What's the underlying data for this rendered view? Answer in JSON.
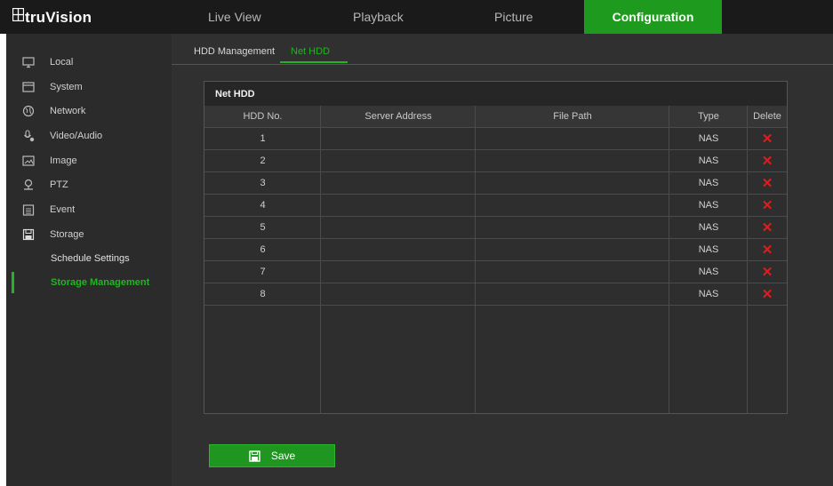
{
  "brand": {
    "logo_text": "truVision"
  },
  "nav": {
    "tabs": [
      {
        "label": "Live View"
      },
      {
        "label": "Playback"
      },
      {
        "label": "Picture"
      },
      {
        "label": "Configuration",
        "active": true
      }
    ]
  },
  "sidebar": {
    "items": [
      {
        "label": "Local",
        "icon": "monitor-icon"
      },
      {
        "label": "System",
        "icon": "system-icon"
      },
      {
        "label": "Network",
        "icon": "globe-icon"
      },
      {
        "label": "Video/Audio",
        "icon": "microphone-icon"
      },
      {
        "label": "Image",
        "icon": "image-icon"
      },
      {
        "label": "PTZ",
        "icon": "ptz-camera-icon"
      },
      {
        "label": "Event",
        "icon": "calendar-icon"
      },
      {
        "label": "Storage",
        "icon": "storage-icon"
      }
    ],
    "subitems": [
      {
        "label": "Schedule Settings",
        "active": false
      },
      {
        "label": "Storage Management",
        "active": true
      }
    ]
  },
  "subtabs": [
    {
      "label": "HDD Management",
      "active": false
    },
    {
      "label": "Net HDD",
      "active": true
    }
  ],
  "table": {
    "title": "Net HDD",
    "columns": [
      "HDD No.",
      "Server Address",
      "File Path",
      "Type",
      "Delete"
    ],
    "rows": [
      {
        "no": "1",
        "server": "",
        "path": "",
        "type": "NAS"
      },
      {
        "no": "2",
        "server": "",
        "path": "",
        "type": "NAS"
      },
      {
        "no": "3",
        "server": "",
        "path": "",
        "type": "NAS"
      },
      {
        "no": "4",
        "server": "",
        "path": "",
        "type": "NAS"
      },
      {
        "no": "5",
        "server": "",
        "path": "",
        "type": "NAS"
      },
      {
        "no": "6",
        "server": "",
        "path": "",
        "type": "NAS"
      },
      {
        "no": "7",
        "server": "",
        "path": "",
        "type": "NAS"
      },
      {
        "no": "8",
        "server": "",
        "path": "",
        "type": "NAS"
      }
    ],
    "delete_glyph": "✕"
  },
  "save": {
    "label": "Save"
  },
  "colors": {
    "accent": "#1e9b1e",
    "delete": "#e21c1c",
    "panel": "#303030",
    "sidebar": "#2b2b2b"
  }
}
